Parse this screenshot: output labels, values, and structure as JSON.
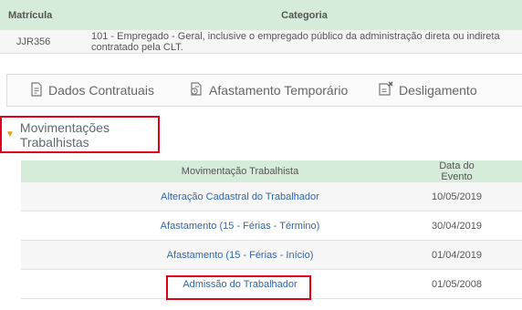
{
  "matricula_table": {
    "headers": [
      "Matrícula",
      "Categoria"
    ],
    "row": {
      "matricula": "JJR356",
      "categoria": "101 - Empregado - Geral, inclusive o empregado público da administração direta ou indireta contratado pela CLT."
    }
  },
  "tabs": [
    {
      "label": "Dados Contratuais",
      "icon": "document-icon"
    },
    {
      "label": "Afastamento Temporário",
      "icon": "leave-document-icon"
    },
    {
      "label": "Desligamento",
      "icon": "termination-document-icon"
    }
  ],
  "section": {
    "title": "Movimentações Trabalhistas",
    "arrow_color": "#e6a11a"
  },
  "movimentacoes_table": {
    "headers": [
      "Movimentação Trabalhista",
      "Data do Evento"
    ],
    "rows": [
      {
        "movimentacao": "Alteração Cadastral do Trabalhador",
        "data": "10/05/2019"
      },
      {
        "movimentacao": "Afastamento (15 - Férias - Término)",
        "data": "30/04/2019"
      },
      {
        "movimentacao": "Afastamento (15 - Férias - Início)",
        "data": "01/04/2019"
      },
      {
        "movimentacao": "Admissão do Trabalhador",
        "data": "01/05/2008"
      }
    ]
  },
  "colors": {
    "header_bg": "#d6ebd9",
    "link": "#3465a4",
    "highlight_border": "#e0001a"
  }
}
